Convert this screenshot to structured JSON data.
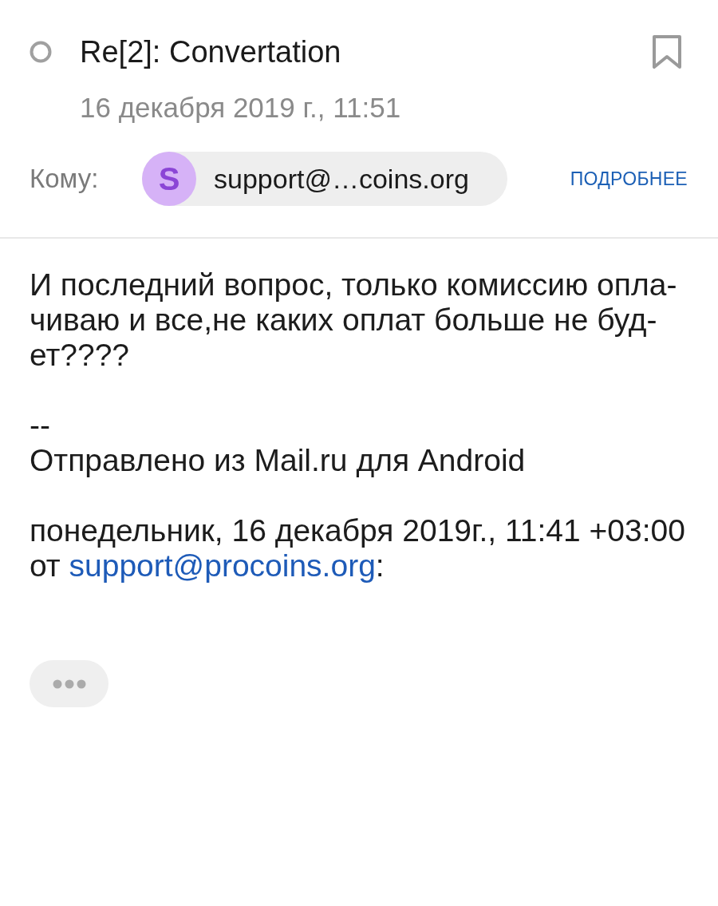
{
  "header": {
    "unread": false,
    "subject": "Re[2]: Convertation",
    "bookmarked": false,
    "date": "16 декабря 2019 г., 11:51"
  },
  "recipients": {
    "label": "Кому:",
    "items": [
      {
        "initial": "S",
        "address": "support@…coins.org"
      }
    ],
    "details_link": "ПОДРОБНЕЕ"
  },
  "body": {
    "text": "И последний вопрос, только комиссию опла-\nчиваю и все,не каких оплат больше не буд-\nет????"
  },
  "signature": {
    "text": "--\nОтправлено из Mail.ru для Android"
  },
  "quote": {
    "date_line": "понедельник, 16 декабря 2019г., 11:41 +03:00",
    "from_prefix": "от",
    "sender_link": "support@procoins.org",
    "suffix": ":"
  }
}
